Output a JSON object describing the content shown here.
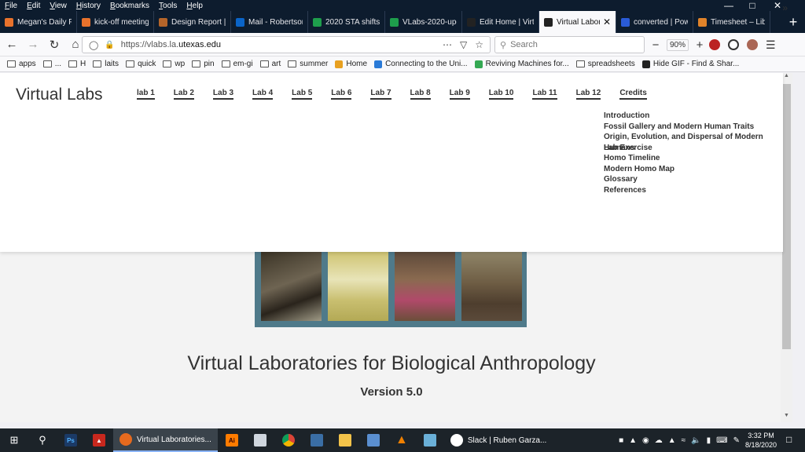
{
  "menubar": {
    "items": [
      "File",
      "Edit",
      "View",
      "History",
      "Bookmarks",
      "Tools",
      "Help"
    ],
    "underline": [
      "F",
      "E",
      "V",
      "H",
      "B",
      "T",
      "H"
    ],
    "rest": [
      "ile",
      "dit",
      "iew",
      "istory",
      "ookmarks",
      "ools",
      "elp"
    ]
  },
  "tabs": [
    {
      "label": "Megan's Daily Pl",
      "color": "#e8722c"
    },
    {
      "label": "kick-off meeting",
      "color": "#e8722c"
    },
    {
      "label": "Design Report |",
      "color": "#b5652a"
    },
    {
      "label": "Mail - Robertson",
      "color": "#0a64c8"
    },
    {
      "label": "2020 STA shifts &",
      "color": "#1e9e4c"
    },
    {
      "label": "VLabs-2020-upd",
      "color": "#1e9e4c"
    },
    {
      "label": "Edit Home | Virt",
      "color": "#222222"
    },
    {
      "label": "Virtual Labor",
      "color": "#222222",
      "active": true
    },
    {
      "label": "converted | Pow",
      "color": "#2a5bd7"
    },
    {
      "label": "Timesheet – Libe",
      "color": "#e0832a"
    }
  ],
  "navbar": {
    "url_prefix": "https://vlabs.la.",
    "url_domain": "utexas.edu",
    "search_placeholder": "Search",
    "zoom": "90%"
  },
  "bookmarks": [
    {
      "label": "apps",
      "type": "folder"
    },
    {
      "label": "...",
      "type": "folder"
    },
    {
      "label": "H",
      "type": "folder"
    },
    {
      "label": "laits",
      "type": "folder"
    },
    {
      "label": "quick",
      "type": "folder"
    },
    {
      "label": "wp",
      "type": "folder"
    },
    {
      "label": "pin",
      "type": "folder"
    },
    {
      "label": "em-gi",
      "type": "folder"
    },
    {
      "label": "art",
      "type": "folder"
    },
    {
      "label": "summer",
      "type": "folder"
    },
    {
      "label": "Home",
      "type": "link",
      "color": "#e8a020"
    },
    {
      "label": "Connecting to the Uni...",
      "type": "link",
      "color": "#2a7ad7"
    },
    {
      "label": "Reviving Machines for...",
      "type": "link",
      "color": "#34a853"
    },
    {
      "label": "spreadsheets",
      "type": "folder"
    },
    {
      "label": "Hide GIF - Find & Shar...",
      "type": "link",
      "color": "#222222"
    }
  ],
  "site": {
    "title": "Virtual Labs",
    "nav": [
      "lab 1",
      "Lab 2",
      "Lab 3",
      "Lab 4",
      "Lab 5",
      "Lab 6",
      "Lab 7",
      "Lab 8",
      "Lab 9",
      "Lab 10",
      "Lab 11",
      "Lab 12",
      "Credits"
    ],
    "dropdown": [
      "Introduction",
      "Fossil Gallery and Modern Human Traits",
      "Origin, Evolution, and Dispersal of Modern"
    ],
    "dropdown_overlap": [
      "Humans",
      "Lab Exercise"
    ],
    "dropdown_rest": [
      "Homo Timeline",
      "Modern Homo Map",
      "Glossary",
      "References"
    ],
    "heading": "Virtual Laboratories for Biological Anthropology",
    "version": "Version 5.0"
  },
  "taskbar": {
    "firefox_label": "Virtual Laboratories...",
    "slack_label": "Slack | Ruben Garza...",
    "time": "3:32 PM",
    "date": "8/18/2020"
  }
}
